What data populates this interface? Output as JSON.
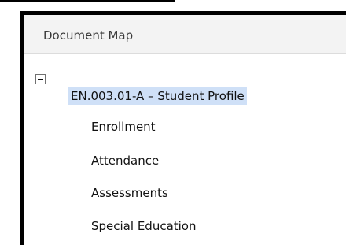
{
  "panel": {
    "title": "Document Map"
  },
  "tree": {
    "root": {
      "label": "EN.003.01-A – Student Profile",
      "expanded": true,
      "toggle_icon": "collapse-minus-icon"
    },
    "children": [
      {
        "label": "Enrollment"
      },
      {
        "label": "Attendance"
      },
      {
        "label": "Assessments"
      },
      {
        "label": "Special Education"
      }
    ]
  },
  "colors": {
    "selection": "#cfe0f7",
    "header_bg": "#f3f3f3"
  }
}
